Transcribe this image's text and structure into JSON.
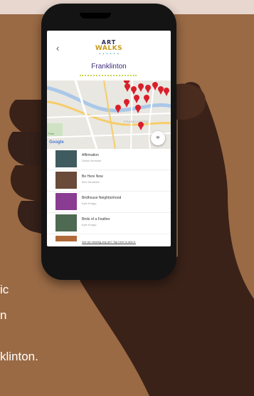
{
  "background_text": {
    "line_1": "ic",
    "line_2": "n",
    "line_3": "klinton."
  },
  "app": {
    "logo_line_1": "ART",
    "logo_line_2": "WALKS",
    "back_icon": "chevron-left-icon",
    "title": "Franklinton"
  },
  "map": {
    "area_label": "FRANKLINTON",
    "park_label": "Park",
    "brand": "Google",
    "locate_icon": "crosshair-icon"
  },
  "artworks": [
    {
      "name": "Affirmation",
      "artist": "David Denholm"
    },
    {
      "name": "Be Here Now",
      "artist": "Ben Strobelen"
    },
    {
      "name": "Birdhouse Neighborhood",
      "artist": "Kyle Knapp"
    },
    {
      "name": "Birds of a Feather",
      "artist": "Kyle Knapp"
    }
  ],
  "footer": {
    "missing_link": "Are we missing any art? Tap here to add it."
  },
  "colors": {
    "background": "#9a6a45",
    "title": "#3c2b7a",
    "pin": "#d9202a",
    "accent_line": "#c8d64a"
  }
}
